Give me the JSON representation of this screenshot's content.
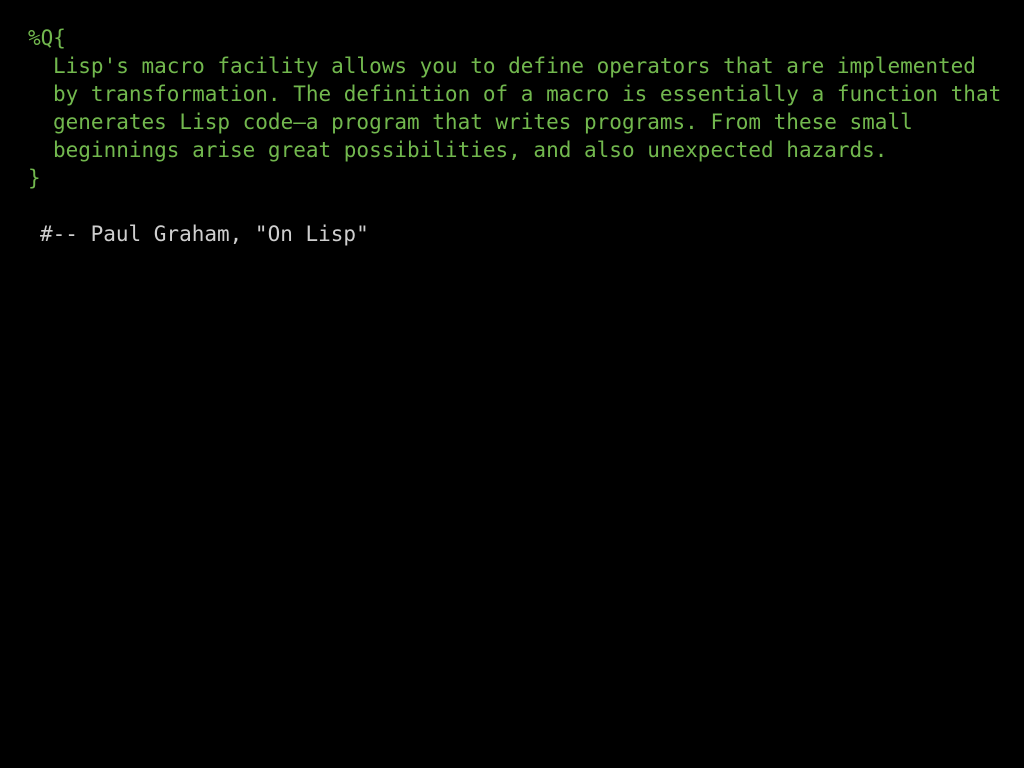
{
  "quote": {
    "open": "%Q{",
    "lines": [
      "Lisp's macro facility allows you to define operators that are implemented",
      "by transformation. The definition of a macro is essentially a function that",
      "generates Lisp code—a program that writes programs. From these small",
      "beginnings arise great possibilities, and also unexpected hazards."
    ],
    "close": "}"
  },
  "attribution": "#-- Paul Graham, \"On Lisp\"",
  "colors": {
    "background": "#000000",
    "quote_text": "#72b84e",
    "attribution_text": "#cfcfcf"
  }
}
